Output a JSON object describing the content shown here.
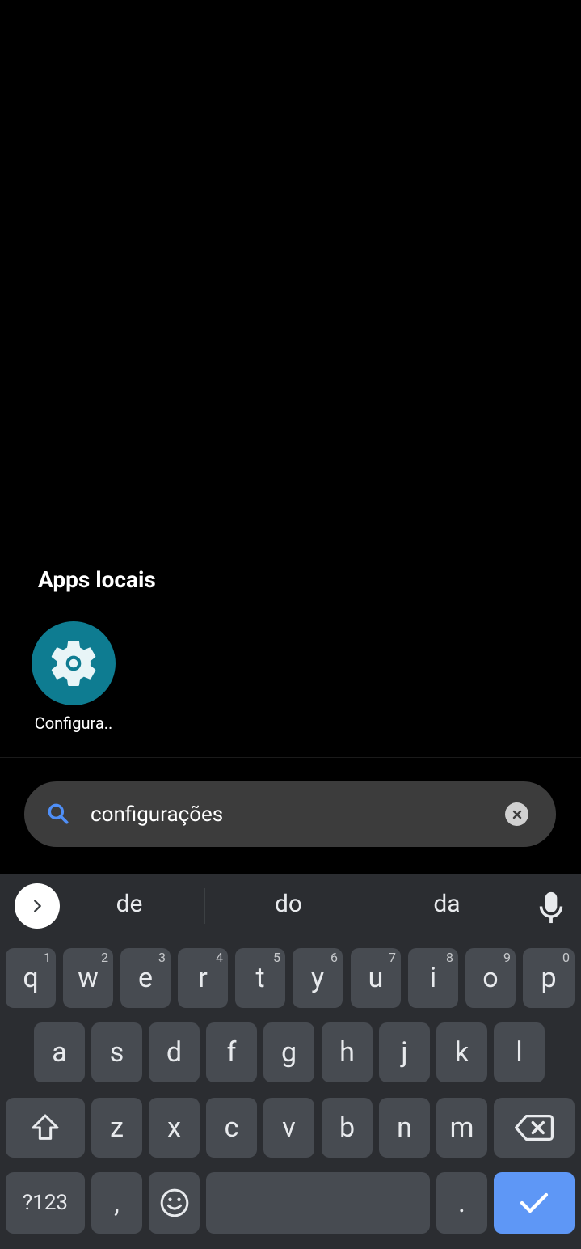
{
  "results": {
    "section_title": "Apps locais",
    "apps": [
      {
        "label": "Configura..",
        "icon": "settings-gear-icon",
        "color": "#0e7c91"
      }
    ]
  },
  "search": {
    "value": "configurações",
    "icon": "search-icon",
    "clear_icon": "clear-icon"
  },
  "keyboard": {
    "suggestions": [
      "de",
      "do",
      "da"
    ],
    "row1": [
      {
        "letter": "q",
        "num": "1"
      },
      {
        "letter": "w",
        "num": "2"
      },
      {
        "letter": "e",
        "num": "3"
      },
      {
        "letter": "r",
        "num": "4"
      },
      {
        "letter": "t",
        "num": "5"
      },
      {
        "letter": "y",
        "num": "6"
      },
      {
        "letter": "u",
        "num": "7"
      },
      {
        "letter": "i",
        "num": "8"
      },
      {
        "letter": "o",
        "num": "9"
      },
      {
        "letter": "p",
        "num": "0"
      }
    ],
    "row2": [
      "a",
      "s",
      "d",
      "f",
      "g",
      "h",
      "j",
      "k",
      "l"
    ],
    "row3": [
      "z",
      "x",
      "c",
      "v",
      "b",
      "n",
      "m"
    ],
    "symbols_label": "?123",
    "comma": ",",
    "period": ".",
    "accent_color": "#5e97f6"
  }
}
